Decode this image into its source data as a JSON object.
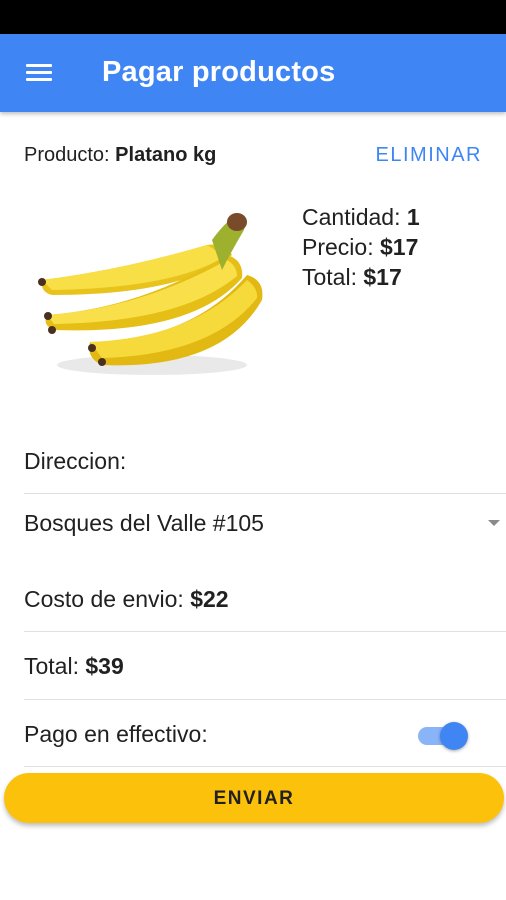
{
  "app_bar": {
    "title": "Pagar productos",
    "menu_icon": "hamburger-menu-icon"
  },
  "product": {
    "label_prefix": "Producto:",
    "name": "Platano kg",
    "delete_label": "ELIMINAR",
    "image": "banana-bunch",
    "quantity_label": "Cantidad:",
    "quantity_value": "1",
    "price_label": "Precio:",
    "price_value": "$17",
    "total_label": "Total:",
    "total_value": "$17"
  },
  "address": {
    "label": "Direccion:",
    "selected": "Bosques del Valle #105",
    "dropdown_icon": "dropdown-arrow-icon"
  },
  "summary": {
    "shipping_label": "Costo de envio:",
    "shipping_value": "$22",
    "total_label": "Total:",
    "total_value": "$39",
    "cash_label": "Pago en effectivo:",
    "cash_enabled": true
  },
  "submit": {
    "label": "ENVIAR"
  },
  "colors": {
    "primary": "#3f86f4",
    "accent": "#fcc10a",
    "status_bar": "#000000"
  }
}
